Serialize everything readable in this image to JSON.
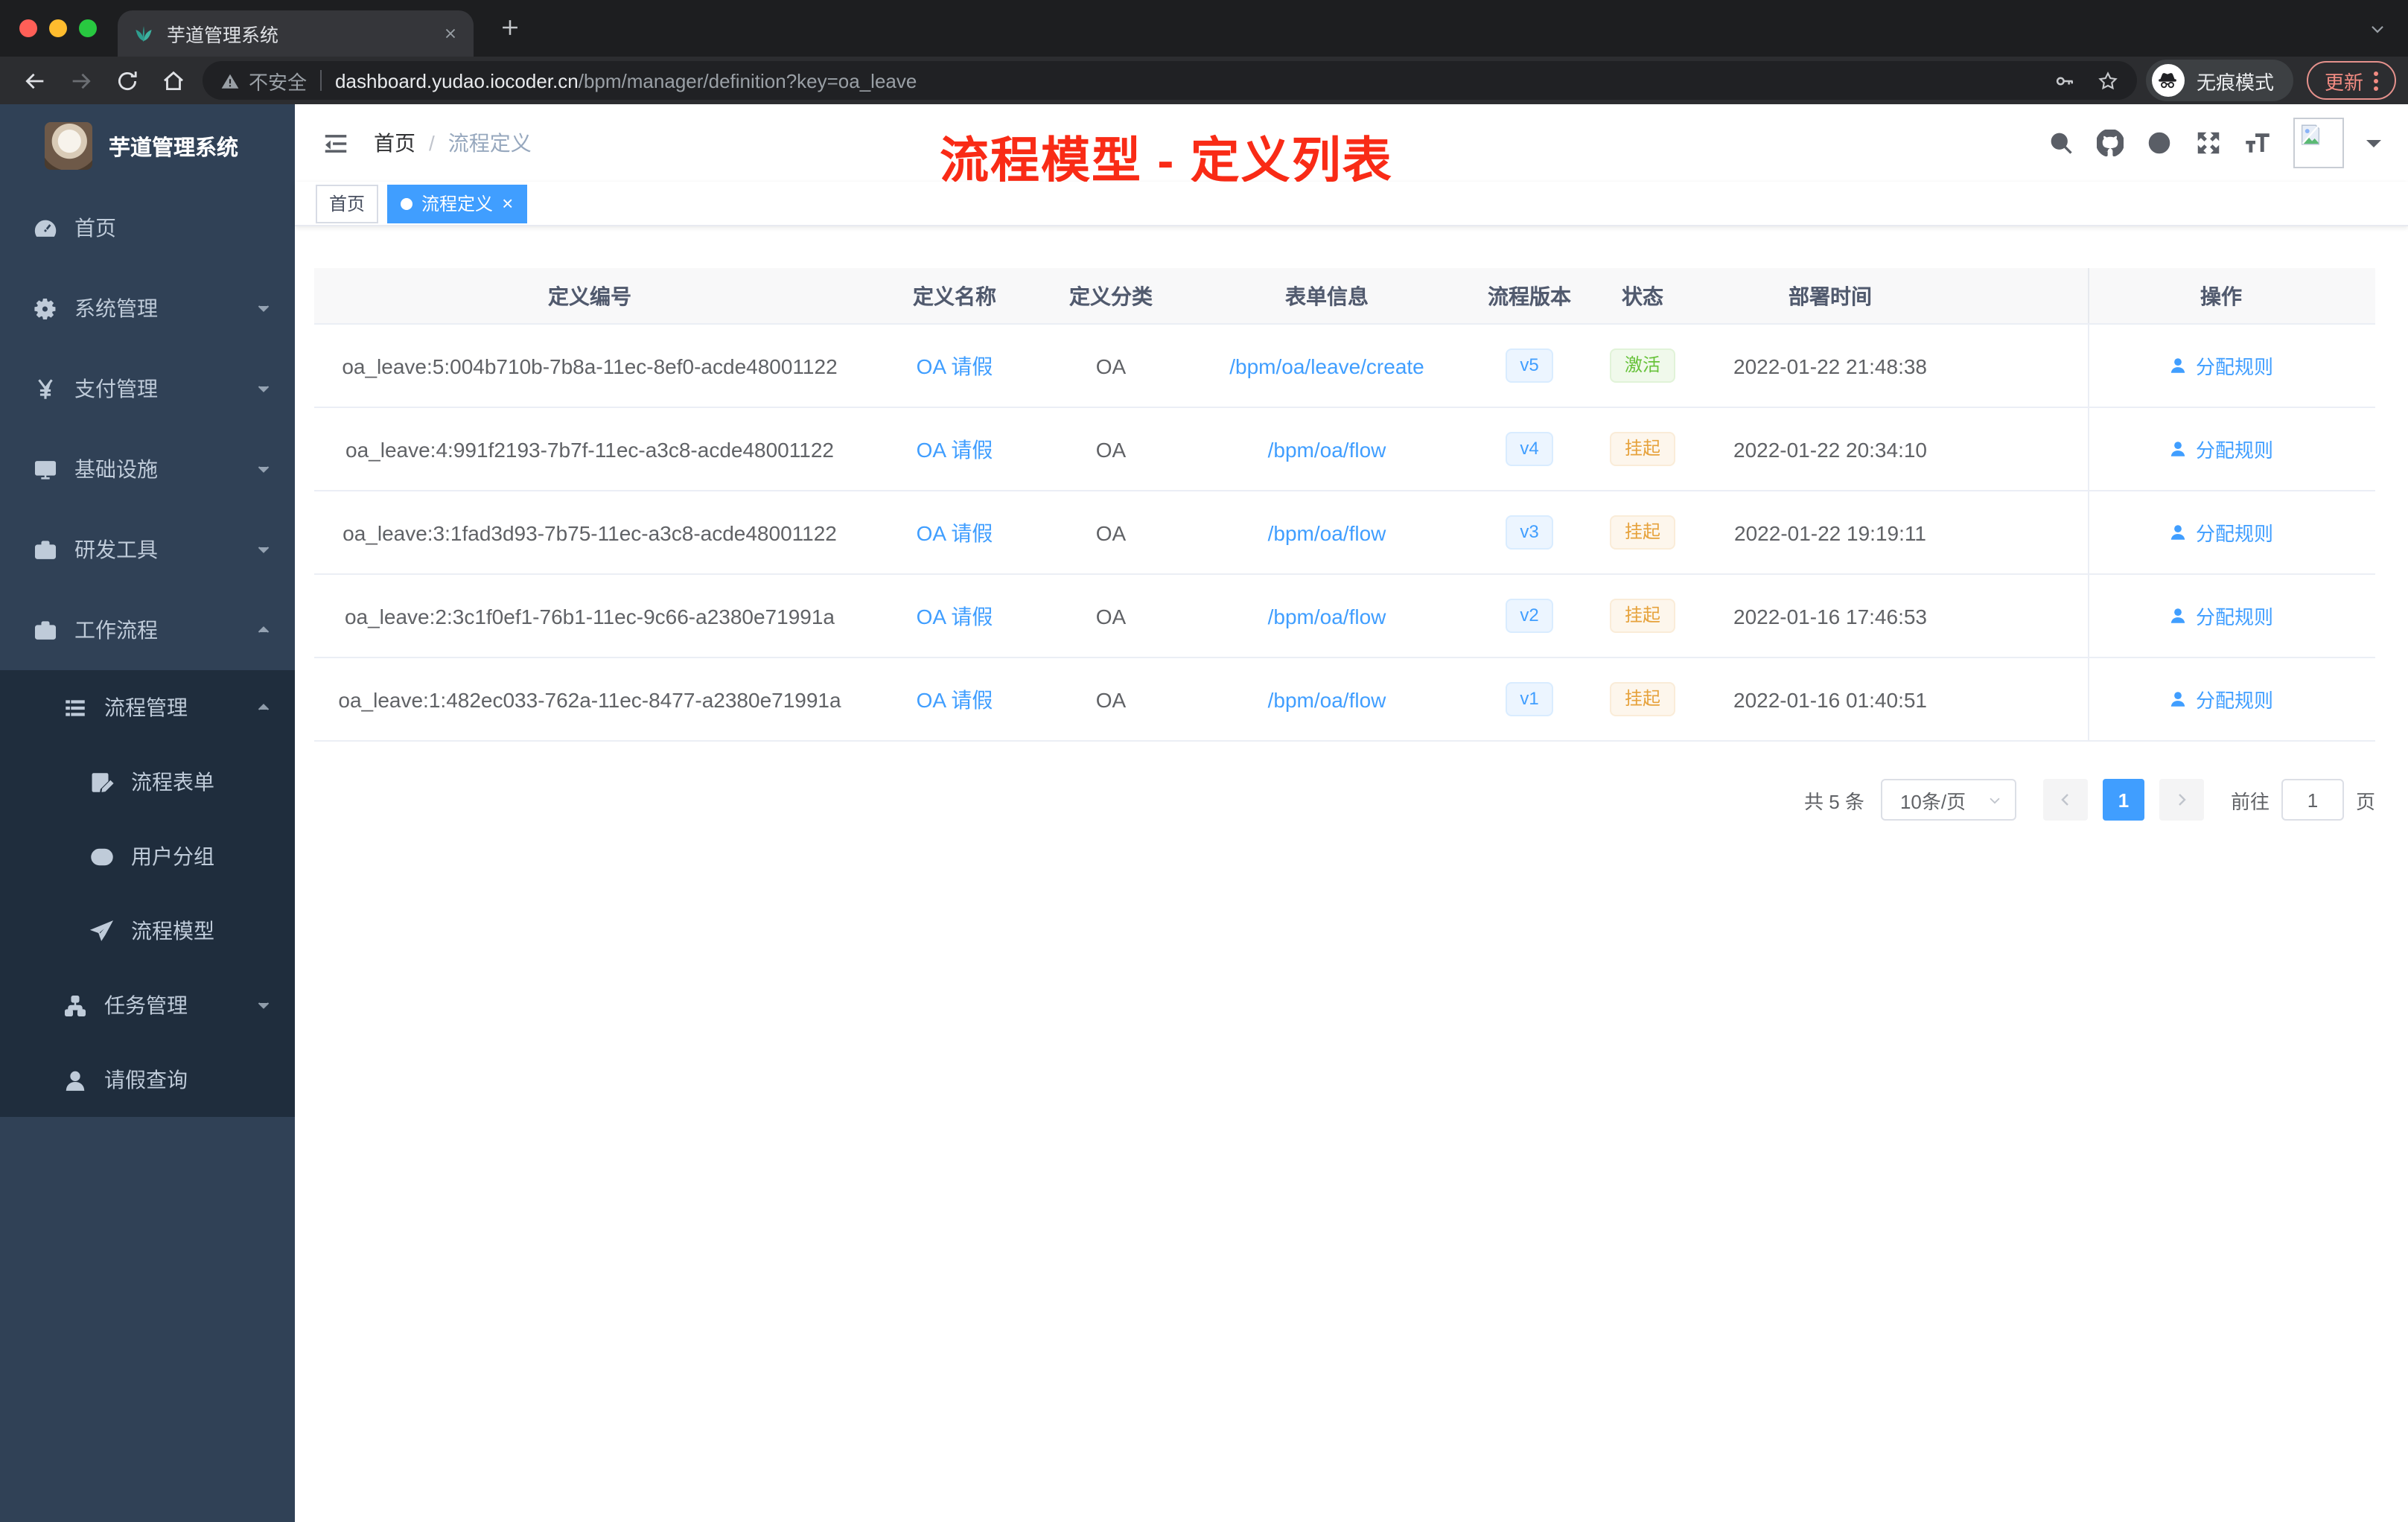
{
  "browser": {
    "tab_title": "芋道管理系统",
    "security_label": "不安全",
    "url_host": "dashboard.yudao.iocoder.cn",
    "url_path": "/bpm/manager/definition?key=oa_leave",
    "incognito_label": "无痕模式",
    "update_label": "更新"
  },
  "sidebar": {
    "logo_title": "芋道管理系统",
    "items": [
      {
        "key": "home",
        "icon": "dashboard",
        "label": "首页",
        "level": 1,
        "arrow": null,
        "sub": false
      },
      {
        "key": "system-management",
        "icon": "gear",
        "label": "系统管理",
        "level": 1,
        "arrow": "down",
        "sub": false
      },
      {
        "key": "payment-management",
        "icon": "yen",
        "label": "支付管理",
        "level": 1,
        "arrow": "down",
        "sub": false
      },
      {
        "key": "infrastructure",
        "icon": "monitor",
        "label": "基础设施",
        "level": 1,
        "arrow": "down",
        "sub": false
      },
      {
        "key": "dev-tools",
        "icon": "toolbox",
        "label": "研发工具",
        "level": 1,
        "arrow": "down",
        "sub": false
      },
      {
        "key": "workflow",
        "icon": "briefcase",
        "label": "工作流程",
        "level": 1,
        "arrow": "up",
        "sub": false
      },
      {
        "key": "process-management",
        "icon": "list",
        "label": "流程管理",
        "level": 2,
        "arrow": "up",
        "sub": true
      },
      {
        "key": "process-form",
        "icon": "form-edit",
        "label": "流程表单",
        "level": 3,
        "arrow": null,
        "sub": true
      },
      {
        "key": "user-group",
        "icon": "user-group",
        "label": "用户分组",
        "level": 3,
        "arrow": null,
        "sub": true
      },
      {
        "key": "process-model",
        "icon": "paper-plane",
        "label": "流程模型",
        "level": 3,
        "arrow": null,
        "sub": true
      },
      {
        "key": "task-management",
        "icon": "tree",
        "label": "任务管理",
        "level": 2,
        "arrow": "down",
        "sub": true
      },
      {
        "key": "leave-query",
        "icon": "user",
        "label": "请假查询",
        "level": 2,
        "arrow": null,
        "sub": true
      }
    ]
  },
  "header": {
    "breadcrumb": {
      "home": "首页",
      "separator": "/",
      "current": "流程定义"
    },
    "annotation": "流程模型 - 定义列表",
    "icons": [
      "search",
      "github",
      "question",
      "fullscreen",
      "font-size"
    ]
  },
  "tags": [
    {
      "key": "home",
      "label": "首页",
      "active": false,
      "dot": false,
      "closable": false
    },
    {
      "key": "process-definition",
      "label": "流程定义",
      "active": true,
      "dot": true,
      "closable": true
    }
  ],
  "table": {
    "columns": [
      "定义编号",
      "定义名称",
      "定义分类",
      "表单信息",
      "流程版本",
      "状态",
      "部署时间",
      "操作"
    ],
    "rows": [
      {
        "id": "oa_leave:5:004b710b-7b8a-11ec-8ef0-acde48001122",
        "name": "OA 请假",
        "category": "OA",
        "form": "/bpm/oa/leave/create",
        "version": "v5",
        "status": "激活",
        "status_type": "success",
        "deploy_time": "2022-01-22 21:48:38",
        "action": "分配规则"
      },
      {
        "id": "oa_leave:4:991f2193-7b7f-11ec-a3c8-acde48001122",
        "name": "OA 请假",
        "category": "OA",
        "form": "/bpm/oa/flow",
        "version": "v4",
        "status": "挂起",
        "status_type": "warning",
        "deploy_time": "2022-01-22 20:34:10",
        "action": "分配规则"
      },
      {
        "id": "oa_leave:3:1fad3d93-7b75-11ec-a3c8-acde48001122",
        "name": "OA 请假",
        "category": "OA",
        "form": "/bpm/oa/flow",
        "version": "v3",
        "status": "挂起",
        "status_type": "warning",
        "deploy_time": "2022-01-22 19:19:11",
        "action": "分配规则"
      },
      {
        "id": "oa_leave:2:3c1f0ef1-76b1-11ec-9c66-a2380e71991a",
        "name": "OA 请假",
        "category": "OA",
        "form": "/bpm/oa/flow",
        "version": "v2",
        "status": "挂起",
        "status_type": "warning",
        "deploy_time": "2022-01-16 17:46:53",
        "action": "分配规则"
      },
      {
        "id": "oa_leave:1:482ec033-762a-11ec-8477-a2380e71991a",
        "name": "OA 请假",
        "category": "OA",
        "form": "/bpm/oa/flow",
        "version": "v1",
        "status": "挂起",
        "status_type": "warning",
        "deploy_time": "2022-01-16 01:40:51",
        "action": "分配规则"
      }
    ]
  },
  "pagination": {
    "total_label": "共 5 条",
    "page_size_label": "10条/页",
    "current_page": "1",
    "goto_label": "前往",
    "goto_value": "1",
    "page_unit_label": "页"
  },
  "colors": {
    "accent": "#409eff",
    "success": "#67c23a",
    "warning": "#e6a23c",
    "annotation_red": "#f92b16",
    "sidebar_bg": "#304156",
    "submenu_bg": "#1f2d3d",
    "active_tag": "#409eff"
  }
}
